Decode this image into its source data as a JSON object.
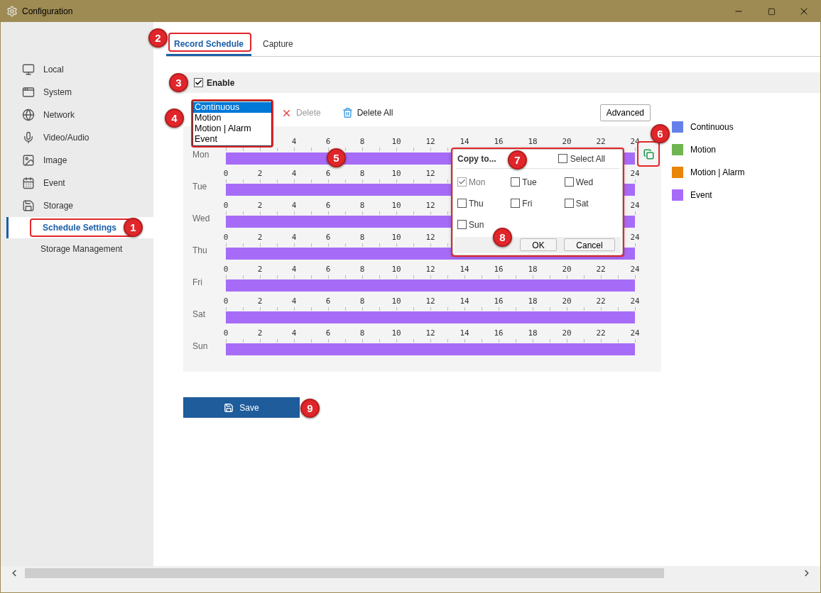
{
  "window": {
    "title": "Configuration"
  },
  "sidebar": {
    "items": [
      {
        "label": "Local",
        "selected": false
      },
      {
        "label": "System",
        "selected": false
      },
      {
        "label": "Network",
        "selected": false
      },
      {
        "label": "Video/Audio",
        "selected": false
      },
      {
        "label": "Image",
        "selected": false
      },
      {
        "label": "Event",
        "selected": false
      },
      {
        "label": "Storage",
        "selected": false,
        "children": [
          {
            "label": "Schedule Settings",
            "selected": true,
            "highlighted": true,
            "callout": "1"
          },
          {
            "label": "Storage Management",
            "selected": false,
            "highlighted": false
          }
        ]
      }
    ]
  },
  "tabs": [
    {
      "label": "Record Schedule",
      "selected": true,
      "highlighted": true,
      "callout": "2"
    },
    {
      "label": "Capture",
      "selected": false,
      "highlighted": false
    }
  ],
  "enable": {
    "label": "Enable",
    "checked": true,
    "callout": "3"
  },
  "toolbar": {
    "record_type_list": {
      "highlighted": true,
      "callout": "4",
      "options": [
        {
          "label": "Continuous",
          "selected": true
        },
        {
          "label": "Motion",
          "selected": false
        },
        {
          "label": "Motion | Alarm",
          "selected": false
        },
        {
          "label": "Event",
          "selected": false
        }
      ]
    },
    "buttons": [
      {
        "label": "Delete",
        "kind": "delete",
        "disabled": true
      },
      {
        "label": "Delete All",
        "kind": "delete_all",
        "disabled": false
      }
    ],
    "advanced": "Advanced"
  },
  "schedule": {
    "callout": "5",
    "copy_button": {
      "highlighted": true,
      "callout": "6"
    },
    "days": [
      {
        "label": "Mon",
        "ticks_end": [
          "4",
          "6",
          "8",
          "10",
          "12",
          "14",
          "16",
          "18",
          "20",
          "22",
          "24"
        ],
        "segments": [
          {
            "kind": "event",
            "level": 1
          }
        ]
      },
      {
        "label": "Tue",
        "ticks_start": [
          "0",
          "2",
          "4",
          "6",
          "8",
          "10",
          "12"
        ],
        "ticks_end": [
          "24"
        ],
        "segments": [
          {
            "kind": "event",
            "level": 1
          }
        ]
      },
      {
        "label": "Wed",
        "ticks_start": [
          "0",
          "2",
          "4",
          "6",
          "8",
          "10",
          "12"
        ],
        "ticks_end": [
          "24"
        ],
        "segments": [
          {
            "kind": "event",
            "level": 1
          }
        ]
      },
      {
        "label": "Thu",
        "ticks_start": [
          "0",
          "2",
          "4",
          "6",
          "8",
          "10",
          "12"
        ],
        "ticks_end": [
          "24"
        ],
        "segments": [
          {
            "kind": "event",
            "level": 1
          }
        ]
      },
      {
        "label": "Fri",
        "ticks_start": [
          "0",
          "2",
          "4",
          "6",
          "8",
          "10",
          "12",
          "14",
          "16",
          "18",
          "20",
          "22",
          "24"
        ],
        "segments": [
          {
            "kind": "event",
            "level": 1
          }
        ]
      },
      {
        "label": "Sat",
        "ticks_start": [
          "0",
          "2",
          "4",
          "6",
          "8",
          "10",
          "12",
          "14",
          "16",
          "18",
          "20",
          "22",
          "24"
        ],
        "segments": [
          {
            "kind": "event",
            "level": 1
          }
        ]
      },
      {
        "label": "Sun",
        "ticks_start": [
          "0",
          "2",
          "4",
          "6",
          "8",
          "10",
          "12",
          "14",
          "16",
          "18",
          "20",
          "22",
          "24"
        ],
        "segments": [
          {
            "kind": "event",
            "level": 1
          }
        ]
      }
    ]
  },
  "copy_dialog": {
    "title": "Copy to...",
    "highlighted": true,
    "title_callout": "7",
    "footer_callout": "8",
    "select_all": {
      "label": "Select All",
      "checked": false
    },
    "days": [
      {
        "label": "Mon",
        "checked": true,
        "disabled": true
      },
      {
        "label": "Tue",
        "checked": false,
        "disabled": false
      },
      {
        "label": "Wed",
        "checked": false,
        "disabled": false
      },
      {
        "label": "Thu",
        "checked": false,
        "disabled": false
      },
      {
        "label": "Fri",
        "checked": false,
        "disabled": false
      },
      {
        "label": "Sat",
        "checked": false,
        "disabled": false
      },
      {
        "label": "Sun",
        "checked": false,
        "disabled": false
      }
    ],
    "buttons": [
      "OK",
      "Cancel"
    ]
  },
  "legend": [
    {
      "label": "Continuous",
      "kind": "continuous",
      "color": "#6680ea"
    },
    {
      "label": "Motion",
      "kind": "motion",
      "color": "#70b550"
    },
    {
      "label": "Motion | Alarm",
      "kind": "motion_alarm",
      "color": "#e8860a"
    },
    {
      "label": "Event",
      "kind": "event",
      "color": "#a66cf8"
    }
  ],
  "save": {
    "label": "Save",
    "callout": "9"
  }
}
